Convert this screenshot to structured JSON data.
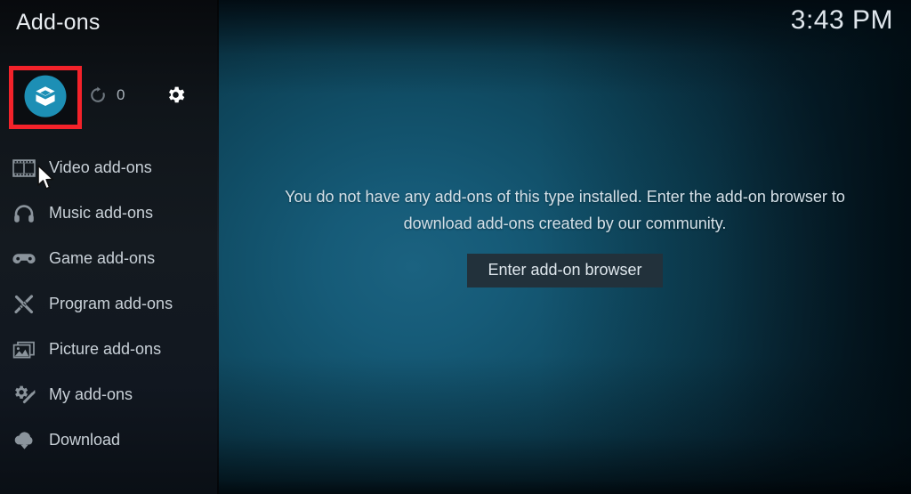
{
  "header": {
    "title": "Add-ons",
    "clock": "3:43 PM"
  },
  "toolbar": {
    "addon_browser": {
      "icon": "open-box-icon",
      "highlighted": true,
      "highlight_color": "#f3222a",
      "circle_color": "#1d8fb5"
    },
    "refresh": {
      "icon": "refresh-icon",
      "count": "0"
    },
    "settings": {
      "icon": "gear-icon"
    }
  },
  "sidebar": {
    "items": [
      {
        "label": "Video add-ons",
        "icon": "film-strip-icon"
      },
      {
        "label": "Music add-ons",
        "icon": "headphones-icon"
      },
      {
        "label": "Game add-ons",
        "icon": "gamepad-icon"
      },
      {
        "label": "Program add-ons",
        "icon": "pencil-ruler-icon"
      },
      {
        "label": "Picture add-ons",
        "icon": "picture-frame-icon"
      },
      {
        "label": "My add-ons",
        "icon": "gear-screwdriver-icon"
      },
      {
        "label": "Download",
        "icon": "download-cloud-icon"
      }
    ]
  },
  "main": {
    "empty_message": "You do not have any add-ons of this type installed. Enter the add-on browser to download add-ons created by our community.",
    "enter_browser_label": "Enter add-on browser"
  },
  "colors": {
    "accent_teal": "#1d8fb5",
    "highlight_red": "#f3222a",
    "sidebar_bg": "#12181e",
    "button_bg": "#22313b",
    "text_primary": "#d4e0e8",
    "text_muted": "#8b949c"
  }
}
